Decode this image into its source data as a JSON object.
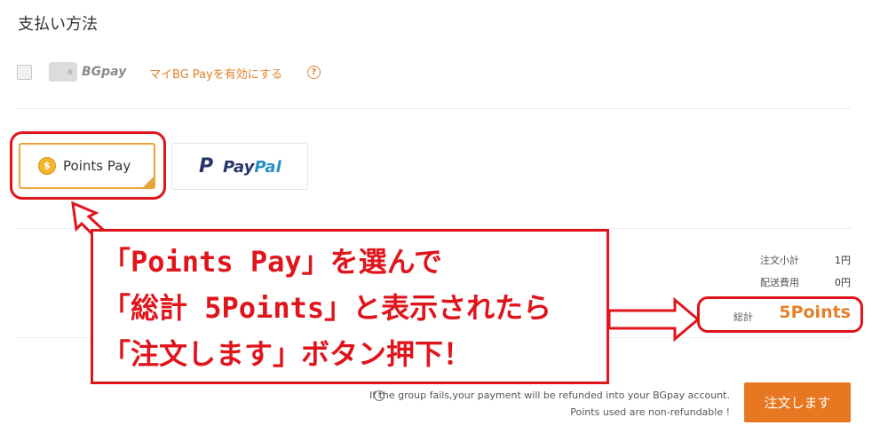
{
  "section_title": "支払い方法",
  "bgpay": {
    "logo_text": "BGpay",
    "enable_link": "マイBG Payを有効にする",
    "help_symbol": "?"
  },
  "methods": [
    {
      "label": "Points Pay",
      "coin_symbol": "$",
      "selected": true
    },
    {
      "label_a": "Pay",
      "label_b": "Pal",
      "selected": false
    }
  ],
  "summary": {
    "subtotal_label": "注文小計",
    "subtotal_value": "1円",
    "shipping_label": "配送費用",
    "shipping_value": "0円",
    "total_label": "総計",
    "total_value": "5Points"
  },
  "notices": {
    "refund": "If the group fails,your payment will be refunded into your BGpay account.",
    "non_refundable": "Points used are non-refundable !"
  },
  "order_button_label": "注文します",
  "annotation": {
    "lines": [
      "「Points Pay」を選んで",
      "「総計 5Points」と表示されたら",
      "「注文します」ボタン押下！"
    ]
  },
  "colors": {
    "accent": "#e3812b",
    "button": "#e87722",
    "annotation_red": "#e0141b",
    "paypal_dark": "#27346a",
    "paypal_light": "#2790c3"
  }
}
